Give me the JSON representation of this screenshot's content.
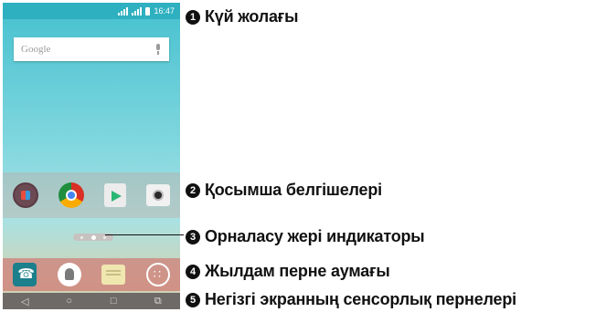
{
  "status_bar": {
    "time": "16:47"
  },
  "search_widget": {
    "text": "Google"
  },
  "app_icons": [
    "lg-apps-icon",
    "chrome-icon",
    "play-store-icon",
    "camera-icon"
  ],
  "page_indicator": {
    "pages": 3,
    "active": 2
  },
  "quick_keys": [
    "phone-icon",
    "contacts-icon",
    "messaging-icon",
    "apps-icon"
  ],
  "nav_keys": [
    "back-icon",
    "home-icon",
    "recent-apps-icon",
    "dual-window-icon"
  ],
  "callouts": [
    {
      "number": "1",
      "label": "Күй жолағы"
    },
    {
      "number": "2",
      "label": "Қосымша белгішелері"
    },
    {
      "number": "3",
      "label": "Орналасу жері индикаторы"
    },
    {
      "number": "4",
      "label": "Жылдам перне аумағы"
    },
    {
      "number": "5",
      "label": "Негізгі экранның сенсорлық пернелері"
    }
  ]
}
